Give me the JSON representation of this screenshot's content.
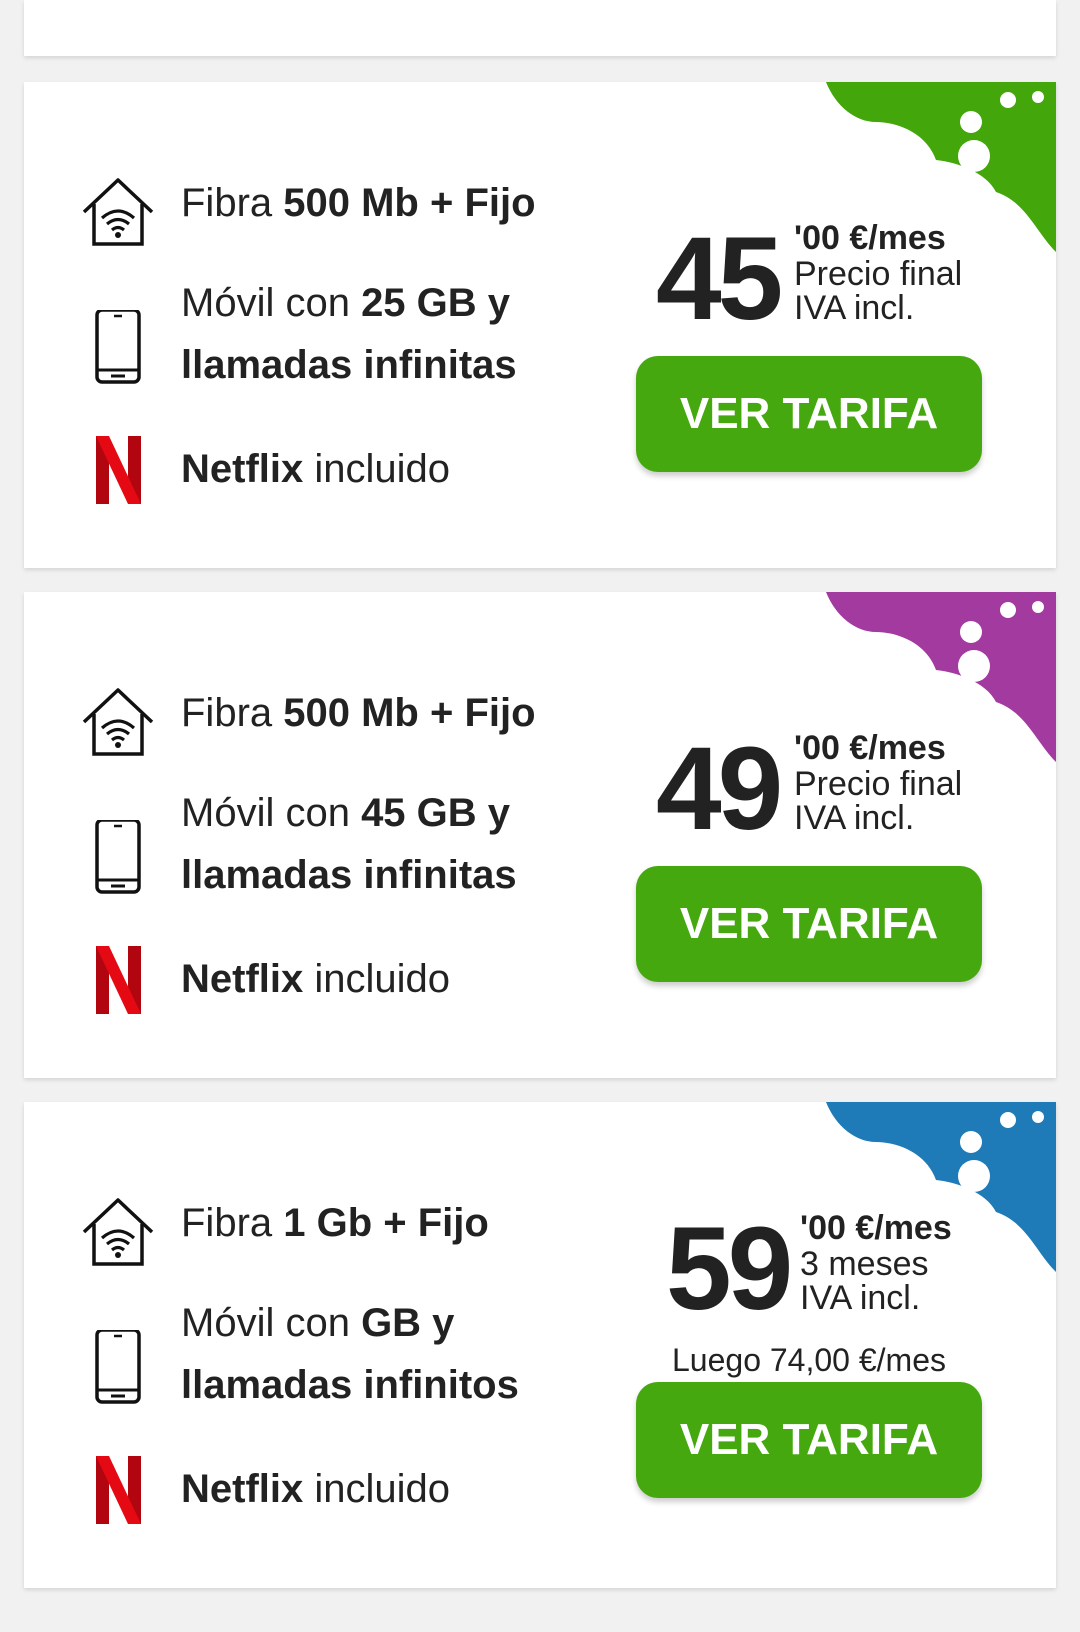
{
  "colors": {
    "page_background": "#f1f1f1",
    "card_background": "#ffffff",
    "button_green": "#44a80e",
    "netflix_red": "#e50914",
    "corner_green": "#43a60a",
    "corner_purple": "#a23aa0",
    "corner_blue": "#1f7ab8"
  },
  "offers": [
    {
      "accent": "#43a60a",
      "fibra": {
        "prefix": "Fibra ",
        "bold": "500 Mb + Fijo"
      },
      "movil": {
        "prefix": "Móvil con ",
        "bold": "25 GB y",
        "line2": "llamadas infinitas"
      },
      "netflix": {
        "bold": "Netflix",
        "suffix": " incluido"
      },
      "price": {
        "whole": "45",
        "cents": "'00 €/mes",
        "line2": "Precio final",
        "line3": "IVA incl."
      },
      "cta": "VER TARIFA"
    },
    {
      "accent": "#a23aa0",
      "fibra": {
        "prefix": "Fibra ",
        "bold": "500 Mb + Fijo"
      },
      "movil": {
        "prefix": "Móvil con ",
        "bold": "45 GB y",
        "line2": "llamadas infinitas"
      },
      "netflix": {
        "bold": "Netflix",
        "suffix": " incluido"
      },
      "price": {
        "whole": "49",
        "cents": "'00 €/mes",
        "line2": "Precio final",
        "line3": "IVA incl."
      },
      "cta": "VER TARIFA"
    },
    {
      "accent": "#1f7ab8",
      "fibra": {
        "prefix": "Fibra ",
        "bold": "1 Gb + Fijo"
      },
      "movil": {
        "prefix": "Móvil con ",
        "bold": "GB y",
        "line2": "llamadas infinitos"
      },
      "netflix": {
        "bold": "Netflix",
        "suffix": " incluido"
      },
      "price": {
        "whole": "59",
        "cents": "'00 €/mes",
        "line2": "3 meses",
        "line3": "IVA incl."
      },
      "after_price": "Luego 74,00 €/mes",
      "cta": "VER TARIFA"
    }
  ],
  "icons": {
    "fibra": "home-wifi-icon",
    "movil": "smartphone-icon",
    "netflix": "netflix-logo-icon"
  }
}
